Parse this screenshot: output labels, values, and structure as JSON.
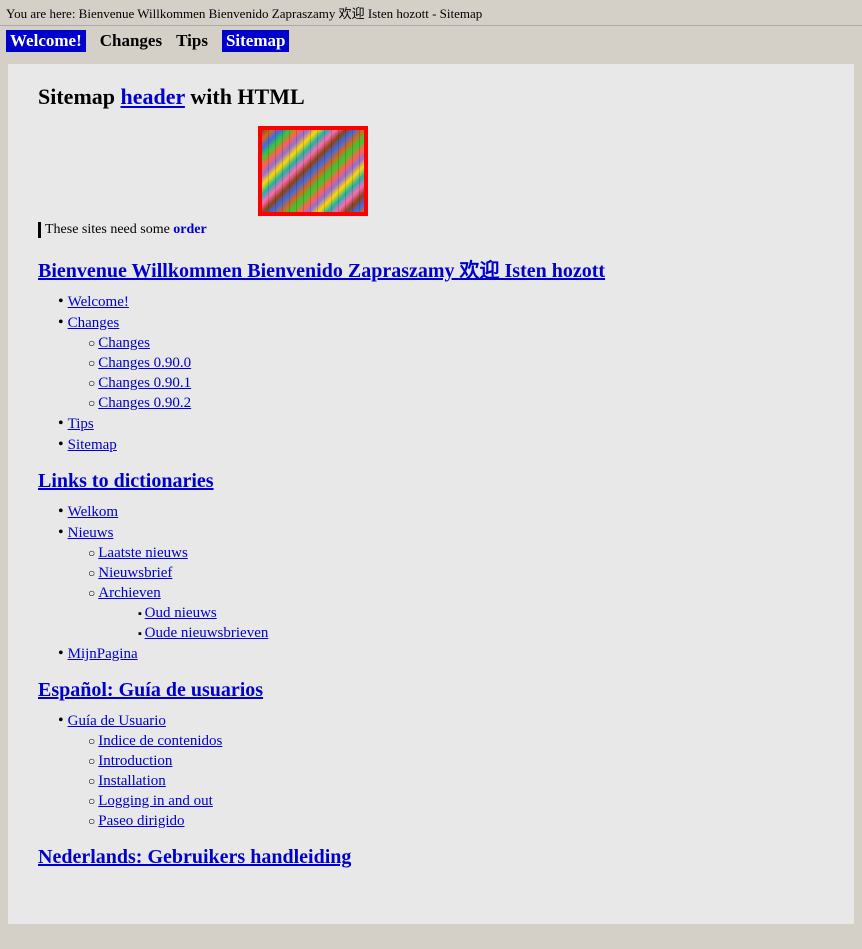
{
  "breadcrumb": {
    "text": "You are here: Bienvenue Willkommen Bienvenido Zapraszamy 欢迎 Isten hozott - Sitemap"
  },
  "nav": {
    "items": [
      {
        "label": "Welcome!",
        "active": true
      },
      {
        "label": "Changes",
        "active": false
      },
      {
        "label": "Tips",
        "active": false
      },
      {
        "label": "Sitemap",
        "active": true
      }
    ]
  },
  "main": {
    "title_plain": "Sitemap ",
    "title_link": "header",
    "title_rest": " with HTML",
    "order_text_plain": "These sites need some ",
    "order_text_link": "order",
    "sections": [
      {
        "id": "bienvenue",
        "heading": "Bienvenue Willkommen Bienvenido Zapraszamy 欢迎 Isten hozott",
        "items": [
          {
            "label": "Welcome!",
            "sub": []
          },
          {
            "label": "Changes",
            "sub": [
              {
                "label": "Changes",
                "subsub": []
              },
              {
                "label": "Changes 0.90.0",
                "subsub": []
              },
              {
                "label": "Changes 0.90.1",
                "subsub": []
              },
              {
                "label": "Changes 0.90.2",
                "subsub": []
              }
            ]
          },
          {
            "label": "Tips",
            "sub": []
          },
          {
            "label": "Sitemap",
            "sub": []
          }
        ]
      },
      {
        "id": "links-dictionaries",
        "heading": "Links to dictionaries",
        "items": [
          {
            "label": "Welkom",
            "sub": []
          },
          {
            "label": "Nieuws",
            "sub": [
              {
                "label": "Laatste nieuws",
                "subsub": []
              },
              {
                "label": "Nieuwsbrief",
                "subsub": []
              },
              {
                "label": "Archieven",
                "subsub": [
                  {
                    "label": "Oud nieuws"
                  },
                  {
                    "label": "Oude nieuwsbrieven"
                  }
                ]
              }
            ]
          },
          {
            "label": "MijnPagina",
            "sub": []
          }
        ]
      },
      {
        "id": "espanol",
        "heading": "Español: Guía de usuarios",
        "items": [
          {
            "label": "Guía de Usuario",
            "sub": [
              {
                "label": "Indice de contenidos",
                "subsub": []
              },
              {
                "label": "Introduction",
                "subsub": []
              },
              {
                "label": "Installation",
                "subsub": []
              },
              {
                "label": "Logging in and out",
                "subsub": []
              },
              {
                "label": "Paseo dirigido",
                "subsub": []
              }
            ]
          }
        ]
      },
      {
        "id": "nederlands",
        "heading": "Nederlands: Gebruikers handleiding",
        "items": []
      }
    ]
  }
}
